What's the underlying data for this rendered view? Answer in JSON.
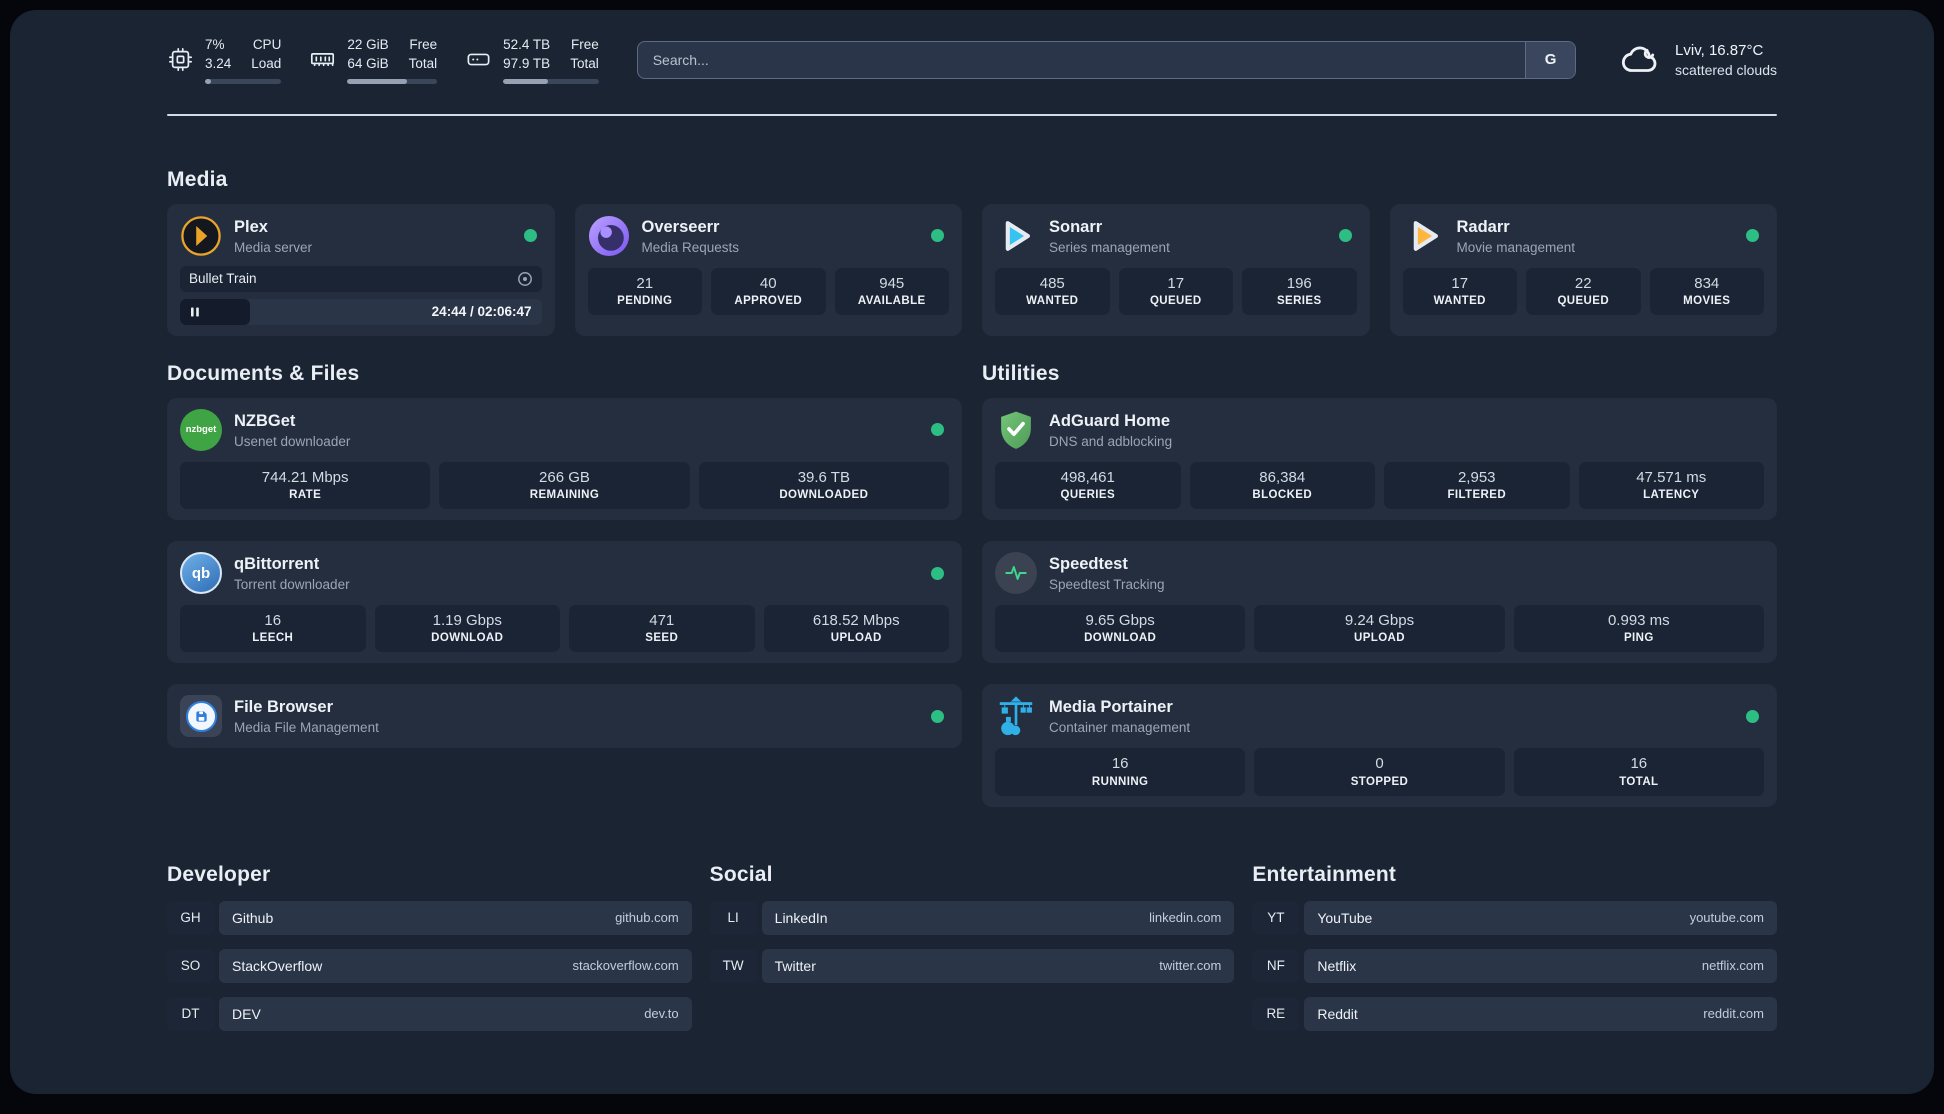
{
  "header": {
    "stats": [
      {
        "icon": "cpu-icon",
        "top_value": "7%",
        "bottom_value": "3.24",
        "top_label": "CPU",
        "bottom_label": "Load",
        "progress_pct": 8
      },
      {
        "icon": "memory-icon",
        "top_value": "22 GiB",
        "bottom_value": "64 GiB",
        "top_label": "Free",
        "bottom_label": "Total",
        "progress_pct": 66
      },
      {
        "icon": "disk-icon",
        "top_value": "52.4 TB",
        "bottom_value": "97.9 TB",
        "top_label": "Free",
        "bottom_label": "Total",
        "progress_pct": 47
      }
    ],
    "search": {
      "placeholder": "Search...",
      "engine_button": "G"
    },
    "weather": {
      "location_temp": "Lviv, 16.87°C",
      "condition": "scattered clouds"
    }
  },
  "sections": {
    "media": {
      "title": "Media",
      "cards": [
        {
          "name": "Plex",
          "subtitle": "Media server",
          "status": "online",
          "now_playing": {
            "title": "Bullet Train",
            "time_display": "24:44 / 02:06:47",
            "progress_pct": 19.5
          }
        },
        {
          "name": "Overseerr",
          "subtitle": "Media Requests",
          "status": "online",
          "stats": [
            {
              "value": "21",
              "label": "PENDING"
            },
            {
              "value": "40",
              "label": "APPROVED"
            },
            {
              "value": "945",
              "label": "AVAILABLE"
            }
          ]
        },
        {
          "name": "Sonarr",
          "subtitle": "Series management",
          "status": "online",
          "stats": [
            {
              "value": "485",
              "label": "WANTED"
            },
            {
              "value": "17",
              "label": "QUEUED"
            },
            {
              "value": "196",
              "label": "SERIES"
            }
          ]
        },
        {
          "name": "Radarr",
          "subtitle": "Movie management",
          "status": "online",
          "stats": [
            {
              "value": "17",
              "label": "WANTED"
            },
            {
              "value": "22",
              "label": "QUEUED"
            },
            {
              "value": "834",
              "label": "MOVIES"
            }
          ]
        }
      ]
    },
    "documents": {
      "title": "Documents & Files",
      "cards": [
        {
          "name": "NZBGet",
          "subtitle": "Usenet downloader",
          "status": "online",
          "stats": [
            {
              "value": "744.21 Mbps",
              "label": "RATE"
            },
            {
              "value": "266 GB",
              "label": "REMAINING"
            },
            {
              "value": "39.6 TB",
              "label": "DOWNLOADED"
            }
          ]
        },
        {
          "name": "qBittorrent",
          "subtitle": "Torrent downloader",
          "status": "online",
          "stats": [
            {
              "value": "16",
              "label": "LEECH"
            },
            {
              "value": "1.19 Gbps",
              "label": "DOWNLOAD"
            },
            {
              "value": "471",
              "label": "SEED"
            },
            {
              "value": "618.52 Mbps",
              "label": "UPLOAD"
            }
          ]
        },
        {
          "name": "File Browser",
          "subtitle": "Media File Management",
          "status": "online"
        }
      ]
    },
    "utilities": {
      "title": "Utilities",
      "cards": [
        {
          "name": "AdGuard Home",
          "subtitle": "DNS and adblocking",
          "stats": [
            {
              "value": "498,461",
              "label": "QUERIES"
            },
            {
              "value": "86,384",
              "label": "BLOCKED"
            },
            {
              "value": "2,953",
              "label": "FILTERED"
            },
            {
              "value": "47.571 ms",
              "label": "LATENCY"
            }
          ]
        },
        {
          "name": "Speedtest",
          "subtitle": "Speedtest Tracking",
          "stats": [
            {
              "value": "9.65 Gbps",
              "label": "DOWNLOAD"
            },
            {
              "value": "9.24 Gbps",
              "label": "UPLOAD"
            },
            {
              "value": "0.993 ms",
              "label": "PING"
            }
          ]
        },
        {
          "name": "Media Portainer",
          "subtitle": "Container management",
          "status": "online",
          "stats": [
            {
              "value": "16",
              "label": "RUNNING"
            },
            {
              "value": "0",
              "label": "STOPPED"
            },
            {
              "value": "16",
              "label": "TOTAL"
            }
          ]
        }
      ]
    },
    "developer": {
      "title": "Developer",
      "links": [
        {
          "abbr": "GH",
          "name": "Github",
          "url": "github.com"
        },
        {
          "abbr": "SO",
          "name": "StackOverflow",
          "url": "stackoverflow.com"
        },
        {
          "abbr": "DT",
          "name": "DEV",
          "url": "dev.to"
        }
      ]
    },
    "social": {
      "title": "Social",
      "links": [
        {
          "abbr": "LI",
          "name": "LinkedIn",
          "url": "linkedin.com"
        },
        {
          "abbr": "TW",
          "name": "Twitter",
          "url": "twitter.com"
        }
      ]
    },
    "entertainment": {
      "title": "Entertainment",
      "links": [
        {
          "abbr": "YT",
          "name": "YouTube",
          "url": "youtube.com"
        },
        {
          "abbr": "NF",
          "name": "Netflix",
          "url": "netflix.com"
        },
        {
          "abbr": "RE",
          "name": "Reddit",
          "url": "reddit.com"
        }
      ]
    }
  },
  "colors": {
    "status_online": "#2dbe84",
    "accent_plex": "#eca227",
    "accent_sonarr": "#37c3f1",
    "accent_radarr": "#ffb63e"
  }
}
